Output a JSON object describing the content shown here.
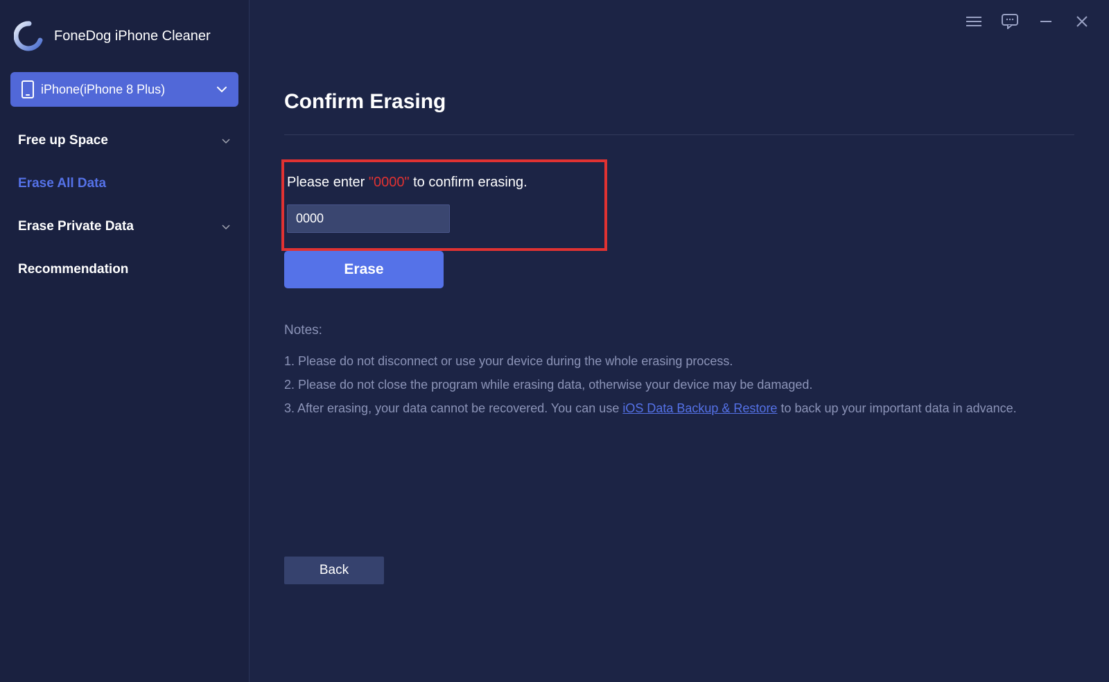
{
  "app": {
    "title": "FoneDog iPhone Cleaner"
  },
  "device": {
    "name": "iPhone(iPhone 8 Plus)"
  },
  "sidebar": {
    "items": [
      {
        "label": "Free up Space",
        "has_chevron": true,
        "active": false
      },
      {
        "label": "Erase All Data",
        "has_chevron": false,
        "active": true
      },
      {
        "label": "Erase Private Data",
        "has_chevron": true,
        "active": false
      },
      {
        "label": "Recommendation",
        "has_chevron": false,
        "active": false
      }
    ]
  },
  "main": {
    "title": "Confirm Erasing",
    "confirm": {
      "prefix": "Please enter ",
      "code": "\"0000\"",
      "suffix": " to confirm erasing.",
      "input_value": "0000"
    },
    "erase_button": "Erase",
    "notes": {
      "heading": "Notes:",
      "items": [
        "1. Please do not disconnect or use your device during the whole erasing process.",
        "2. Please do not close the program while erasing data, otherwise your device may be damaged."
      ],
      "item3_prefix": "3. After erasing, your data cannot be recovered. You can use ",
      "item3_link": "iOS Data Backup & Restore",
      "item3_suffix": " to back up your important data in advance."
    },
    "back_button": "Back"
  }
}
